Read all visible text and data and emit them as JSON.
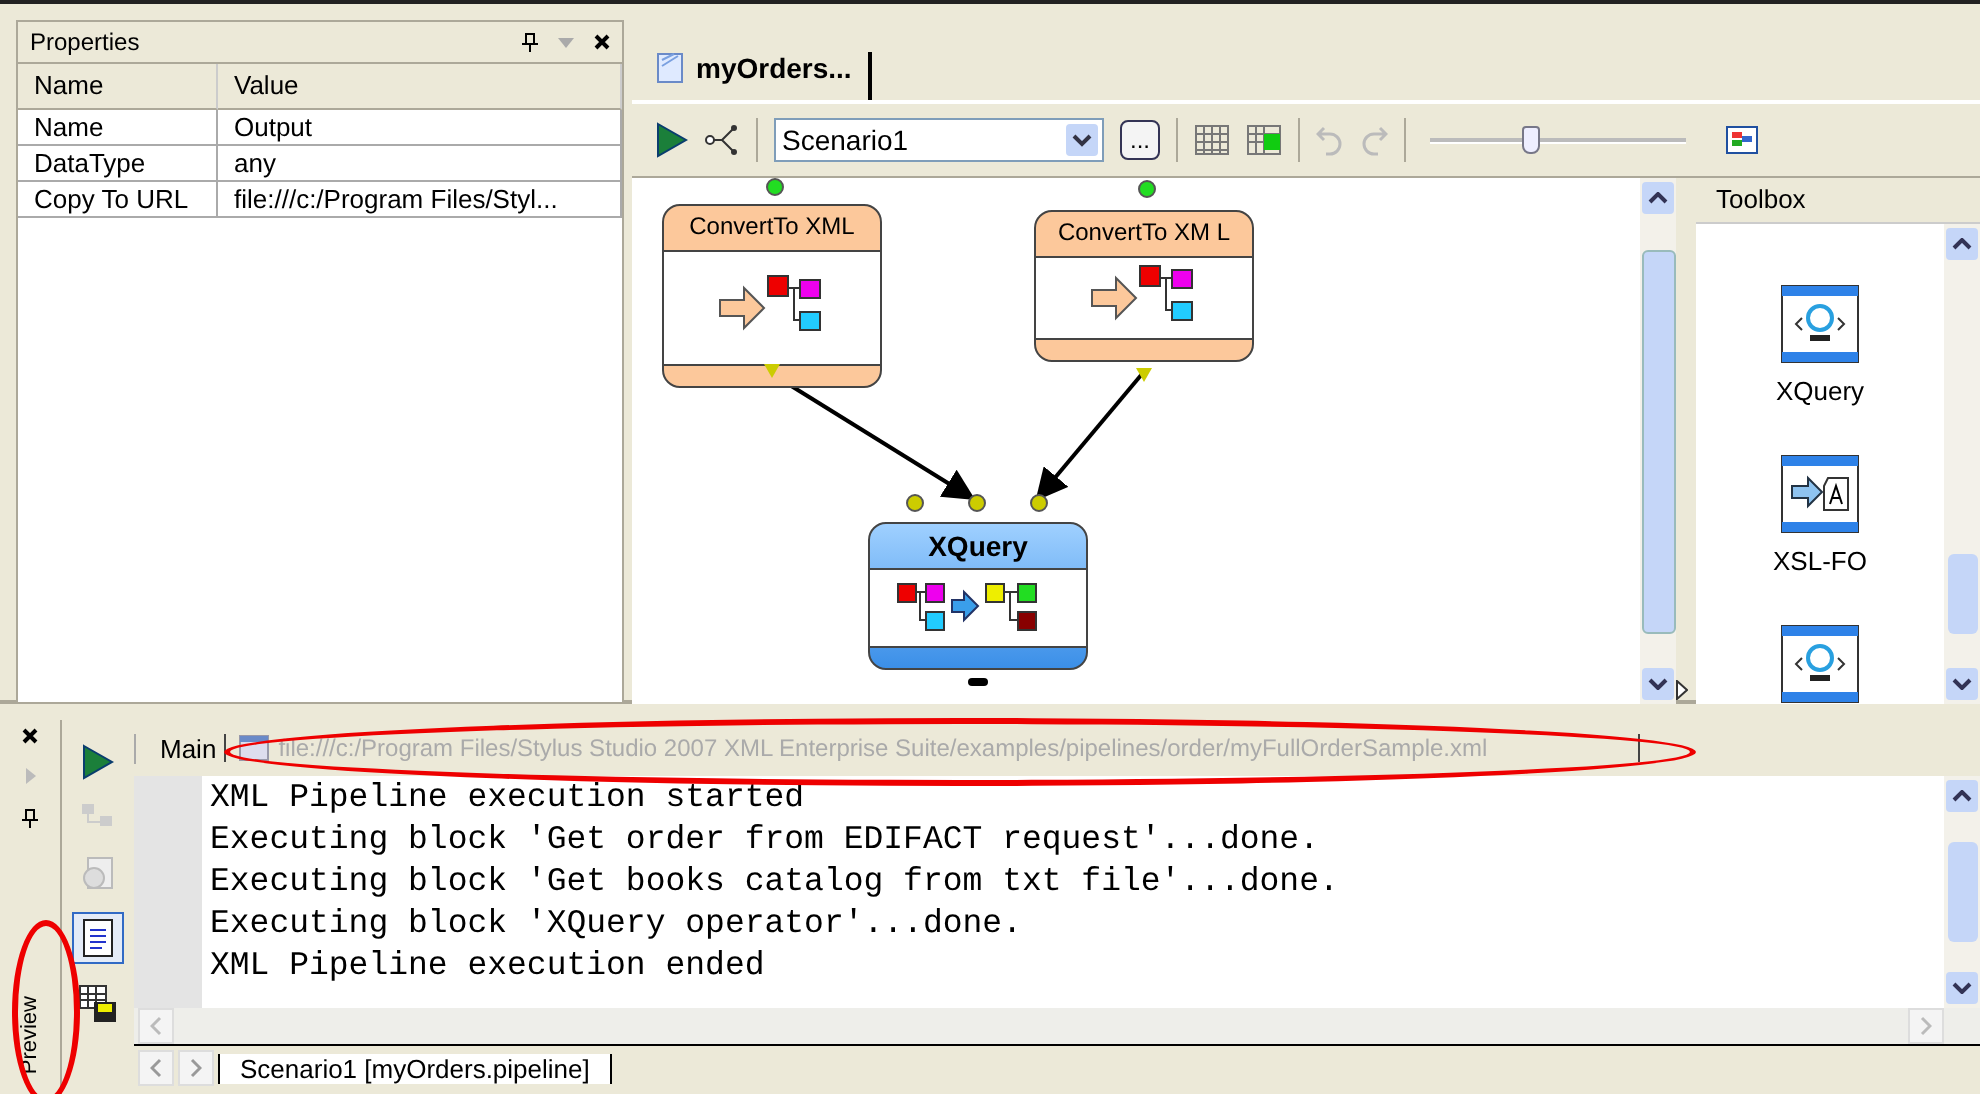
{
  "properties_panel": {
    "title": "Properties",
    "columns": [
      "Name",
      "Value"
    ],
    "rows": [
      {
        "name": "Name",
        "value": "Output"
      },
      {
        "name": "DataType",
        "value": "any"
      },
      {
        "name": "Copy To URL",
        "value": "file:///c:/Program Files/Styl..."
      }
    ]
  },
  "editor": {
    "tabs": [
      {
        "label": "myOrders...",
        "selected": true
      }
    ],
    "toolbar": {
      "scenario": "Scenario1",
      "browse_button": "...",
      "zoom": {
        "level": 0.39
      }
    },
    "diagram": {
      "nodes": [
        {
          "title": "ConvertTo XML",
          "kind": "convert"
        },
        {
          "title": "ConvertTo XM L",
          "kind": "convert"
        },
        {
          "title": "XQuery",
          "kind": "xquery"
        }
      ]
    },
    "toolbox": {
      "title": "Toolbox",
      "items": [
        {
          "label": "XQuery",
          "kind": "xquery"
        },
        {
          "label": "XSL-FO",
          "kind": "xslfo"
        },
        {
          "kind": "xquery"
        }
      ]
    }
  },
  "output_panel": {
    "side_label": "Preview",
    "tab": "Main",
    "url": "file:///c:/Program Files/Stylus Studio 2007 XML Enterprise Suite/examples/pipelines/order/myFullOrderSample.xml",
    "lines": [
      "XML Pipeline execution started",
      "Executing block 'Get order from EDIFACT request'...done.",
      "Executing block 'Get books catalog from txt file'...done.",
      "Executing block 'XQuery operator'...done.",
      "XML Pipeline execution ended"
    ],
    "bottom_tabs": [
      {
        "label": "Scenario1 [myOrders.pipeline]",
        "selected": true
      }
    ],
    "url_highlighted": true,
    "side_label_highlighted": true
  }
}
